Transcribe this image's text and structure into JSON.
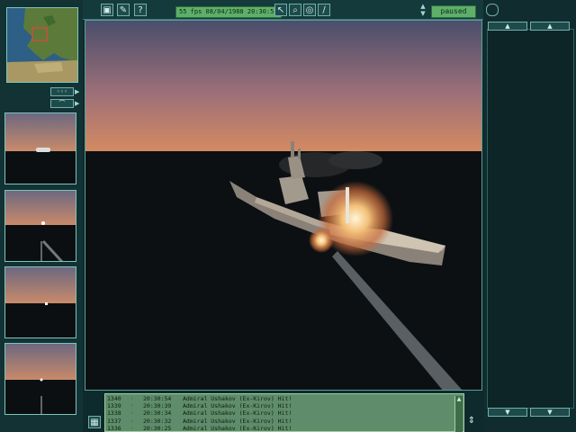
{
  "top_bar": {
    "fps_status": "55 fps 08/04/1988 20:30:55",
    "time_status": "paused",
    "help_label": "?"
  },
  "icons": {
    "cube": "cube-icon",
    "wrench": "wrench-icon",
    "help": "help-icon",
    "cursor": "cursor-icon",
    "zoom": "zoom-icon",
    "target": "target-icon",
    "pencil": "pencil-icon",
    "chevron_up": "chevron-up-icon",
    "chevron_down": "chevron-down-icon"
  },
  "log": {
    "rows": [
      {
        "id": "1340",
        "time": "20:30:54",
        "message": "Admiral Ushakov (Ex-Kirov) Hit!"
      },
      {
        "id": "1339",
        "time": "20:30:39",
        "message": "Admiral Ushakov (Ex-Kirov) Hit!"
      },
      {
        "id": "1338",
        "time": "20:30:34",
        "message": "Admiral Ushakov (Ex-Kirov) Hit!"
      },
      {
        "id": "1337",
        "time": "20:30:32",
        "message": "Admiral Ushakov (Ex-Kirov) Hit!"
      },
      {
        "id": "1336",
        "time": "20:30:25",
        "message": "Admiral Ushakov (Ex-Kirov) Hit!"
      }
    ]
  },
  "colors": {
    "frame": "#143638",
    "accent": "#6fb0aa",
    "status_green": "#5faf6a",
    "sky_top": "#4a4e6c",
    "sky_horizon": "#d48a62",
    "sea": "#0c1013"
  }
}
